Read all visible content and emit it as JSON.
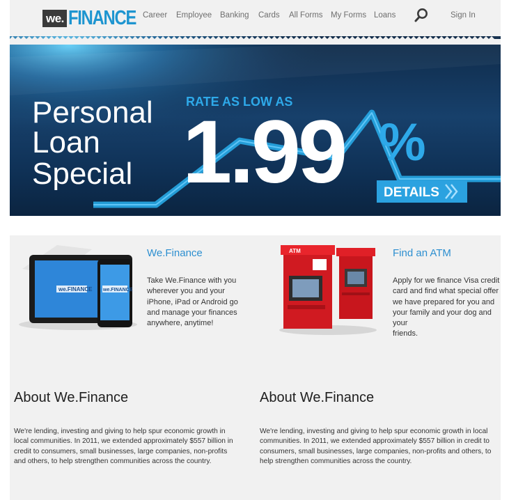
{
  "brand": {
    "logo_prefix": "we.",
    "logo_name": "FINANCE",
    "accent": "#1e95d0"
  },
  "nav": {
    "items": [
      "Career",
      "Employee",
      "Banking",
      "Cards",
      "All Forms",
      "My Forms",
      "Loans"
    ],
    "search_icon": "search-icon",
    "signin": "Sign In"
  },
  "hero": {
    "line1": "Personal",
    "line2": "Loan",
    "line3": "Special",
    "rate_label": "RATE AS LOW AS",
    "rate": "1.99",
    "percent": "%",
    "details": "DETAILS"
  },
  "features": [
    {
      "title": "We.Finance",
      "text": "Take We.Finance with you wherever you and your iPhone, iPad or Android go and manage your finances anywhere, anytime!",
      "lines": [
        "Take We.Finance with you",
        "wherever you and your",
        "iPhone, iPad or Android go",
        "and manage your finances",
        "anywhere, anytime!"
      ],
      "device_logo": "we.FINANCE"
    },
    {
      "title": "Find an ATM",
      "text": "Apply for we finance Visa credit card and find what special offer we have prepared for you and your family and your dog and your friends.",
      "lines": [
        "Apply for we finance Visa credit",
        "card and find what special offer",
        "we have prepared for you and",
        "your family and your dog and your",
        "friends."
      ],
      "atm_label": "ATM"
    }
  ],
  "about": [
    {
      "title": "About We.Finance",
      "lines": [
        "We're lending, investing and giving to help spur economic growth in",
        "local communities. In 2011, we extended approximately $557 billion in",
        "credit to consumers, small businesses, large companies, non-profits",
        "and others, to help strengthen communities across the country."
      ]
    },
    {
      "title": "About We.Finance",
      "lines": [
        "We're lending, investing and giving to help spur economic growth in local",
        "communities. In 2011, we extended approximately $557 billion in credit to",
        "consumers, small businesses, large companies, non-profits and others, to",
        "help strengthen communities across the country."
      ]
    }
  ]
}
